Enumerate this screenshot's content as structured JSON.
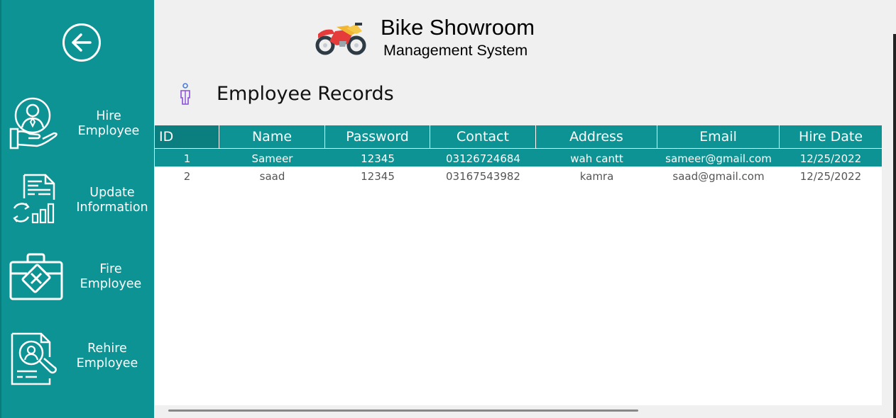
{
  "header": {
    "title": "Bike Showroom",
    "subtitle": "Management System"
  },
  "section": {
    "title": "Employee Records"
  },
  "sidebar": {
    "items": [
      {
        "label": "Hire\nEmployee",
        "icon": "hire-employee-icon"
      },
      {
        "label": "Update\nInformation",
        "icon": "update-information-icon"
      },
      {
        "label": "Fire\nEmployee",
        "icon": "fire-employee-icon"
      },
      {
        "label": "Rehire\nEmployee",
        "icon": "rehire-employee-icon"
      }
    ]
  },
  "table": {
    "columns": [
      "ID",
      "Name",
      "Password",
      "Contact",
      "Address",
      "Email",
      "Hire Date"
    ],
    "rows": [
      [
        "1",
        "Sameer",
        "12345",
        "03126724684",
        "wah cantt",
        "sameer@gmail.com",
        "12/25/2022"
      ],
      [
        "2",
        "saad",
        "12345",
        "03167543982",
        "kamra",
        "saad@gmail.com",
        "12/25/2022"
      ]
    ],
    "selected_row": 0
  },
  "colors": {
    "accent": "#0d9393",
    "background": "#f0f0f0"
  }
}
